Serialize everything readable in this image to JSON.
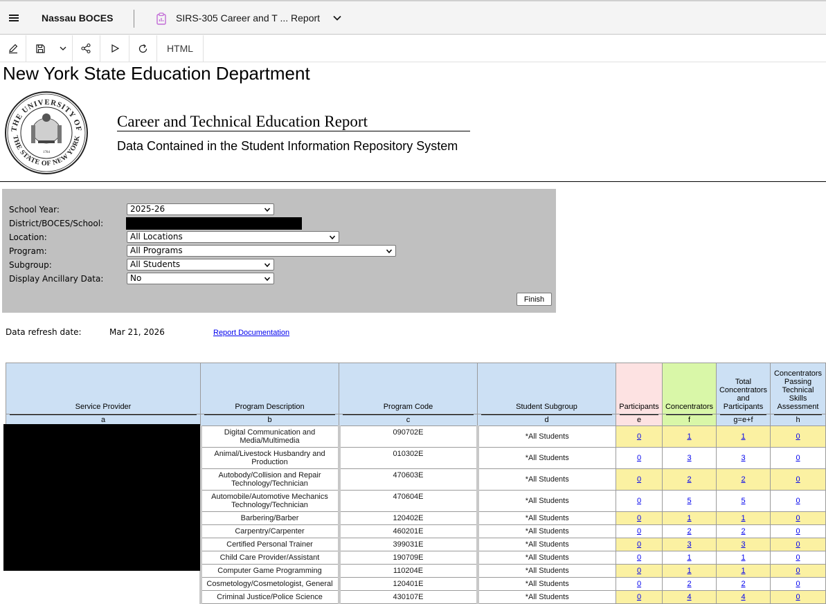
{
  "topbar": {
    "org_name": "Nassau BOCES",
    "report_title": "SIRS-305 Career and T ... Report",
    "icons": [
      "hamburger-icon",
      "clipboard-icon",
      "chevron-down-icon"
    ]
  },
  "toolbar": {
    "icons": [
      "edit-icon",
      "save-icon",
      "chevron-down-icon",
      "share-icon",
      "run-icon",
      "refresh-icon"
    ],
    "format_label": "HTML"
  },
  "header": {
    "agency": "New York State Education Department",
    "title": "Career and Technical Education Report",
    "subtitle": "Data Contained in the Student Information Repository System",
    "seal_icon": "nys-seal-icon",
    "seal_text_top": "THE UNIVERSITY OF",
    "seal_text_bottom": "THE STATE OF NEW YORK",
    "seal_year": "1784"
  },
  "filters": {
    "school_year_label": "School Year:",
    "school_year_value": "2025-26",
    "district_label": "District/BOCES/School:",
    "location_label": "Location:",
    "location_value": "All Locations",
    "program_label": "Program:",
    "program_value": "All Programs",
    "subgroup_label": "Subgroup:",
    "subgroup_value": "All Students",
    "ancillary_label": "Display Ancillary Data:",
    "ancillary_value": "No",
    "finish_label": "Finish"
  },
  "refresh": {
    "label": "Data refresh date:",
    "value": "Mar 21, 2026",
    "doc_link": "Report Documentation"
  },
  "table": {
    "headers": [
      {
        "label": "Service Provider",
        "letter": "a"
      },
      {
        "label": "Program Description",
        "letter": "b"
      },
      {
        "label": "Program Code",
        "letter": "c"
      },
      {
        "label": "Student Subgroup",
        "letter": "d"
      },
      {
        "label": "Participants",
        "letter": "e"
      },
      {
        "label": "Concentrators",
        "letter": "f"
      },
      {
        "label": "Total Concentrators and Participants",
        "letter": "g=e+f"
      },
      {
        "label": "Concentrators Passing Technical Skills Assessment",
        "letter": "h"
      }
    ],
    "rows": [
      {
        "description": "Digital Communication and Media/Multimedia",
        "code": "090702E",
        "subgroup": "*All Students",
        "e": "0",
        "f": "1",
        "g": "1",
        "h": "0"
      },
      {
        "description": "Animal/Livestock Husbandry and Production",
        "code": "010302E",
        "subgroup": "*All Students",
        "e": "0",
        "f": "3",
        "g": "3",
        "h": "0"
      },
      {
        "description": "Autobody/Collision and Repair Technology/Technician",
        "code": "470603E",
        "subgroup": "*All Students",
        "e": "0",
        "f": "2",
        "g": "2",
        "h": "0"
      },
      {
        "description": "Automobile/Automotive Mechanics Technology/Technician",
        "code": "470604E",
        "subgroup": "*All Students",
        "e": "0",
        "f": "5",
        "g": "5",
        "h": "0"
      },
      {
        "description": "Barbering/Barber",
        "code": "120402E",
        "subgroup": "*All Students",
        "e": "0",
        "f": "1",
        "g": "1",
        "h": "0"
      },
      {
        "description": "Carpentry/Carpenter",
        "code": "460201E",
        "subgroup": "*All Students",
        "e": "0",
        "f": "2",
        "g": "2",
        "h": "0"
      },
      {
        "description": "Certified Personal Trainer",
        "code": "399031E",
        "subgroup": "*All Students",
        "e": "0",
        "f": "3",
        "g": "3",
        "h": "0"
      },
      {
        "description": "Child Care Provider/Assistant",
        "code": "190709E",
        "subgroup": "*All Students",
        "e": "0",
        "f": "1",
        "g": "1",
        "h": "0"
      },
      {
        "description": "Computer Game Programming",
        "code": "110204E",
        "subgroup": "*All Students",
        "e": "0",
        "f": "1",
        "g": "1",
        "h": "0"
      },
      {
        "description": "Cosmetology/Cosmetologist, General",
        "code": "120401E",
        "subgroup": "*All Students",
        "e": "0",
        "f": "2",
        "g": "2",
        "h": "0"
      },
      {
        "description": "Criminal Justice/Police Science",
        "code": "430107E",
        "subgroup": "*All Students",
        "e": "0",
        "f": "4",
        "g": "4",
        "h": "0"
      }
    ]
  },
  "colors": {
    "header_blue": "#cce0f4",
    "participants_pink": "#fde2e2",
    "concentrators_green": "#d9f7a8",
    "highlight_yellow": "#fbf1a2",
    "filter_panel_gray": "#c0c0c0",
    "link_blue": "#0000ee"
  }
}
